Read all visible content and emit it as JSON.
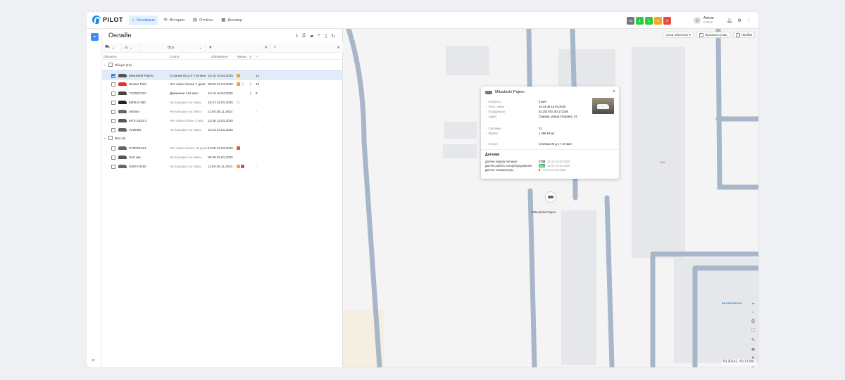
{
  "brand": {
    "name": "PILOT"
  },
  "nav": {
    "tabs": [
      {
        "label": "Основные",
        "icon": "home-icon"
      },
      {
        "label": "История",
        "icon": "history-icon"
      },
      {
        "label": "Отчёты",
        "icon": "report-icon"
      },
      {
        "label": "Договор",
        "icon": "contract-icon"
      }
    ]
  },
  "status_badges": [
    {
      "count": "10",
      "color": "#777777"
    },
    {
      "count": "1",
      "color": "#2ecc40"
    },
    {
      "count": "1",
      "color": "#2ecc40"
    },
    {
      "count": "0",
      "color": "#f5a623"
    },
    {
      "count": "0",
      "color": "#e74c3c"
    }
  ],
  "user": {
    "name": "Алена",
    "balance": "0.00 ₽"
  },
  "panel": {
    "title": "Онлайн",
    "filter_all": "Все",
    "columns": {
      "objects": "Объекты",
      "status": "Статус",
      "updated": "Обновлено",
      "tags": "Метки"
    }
  },
  "groups": [
    {
      "label": "Общая (10)"
    },
    {
      "label": "Моя (3)"
    }
  ],
  "vehicles": [
    {
      "name": "Mitsubishi Pajero",
      "status": "Стоянка 00 д 4 ч 39 мин",
      "updated": "16:16 10.04.2025",
      "extra": "12",
      "color": "#555"
    },
    {
      "name": "Nissan Tiida",
      "status": "Нет связи более 7 дней",
      "updated": "08:53 04.04.2025",
      "extra": "19",
      "color": "#d33"
    },
    {
      "name": "T100ЕЕ761",
      "status": "Движение 144 км/ч",
      "updated": "16:19 10.04.2025",
      "extra": "9",
      "color": "#444"
    },
    {
      "name": "К804АУ190",
      "status": "Не выходил на связь",
      "updated": "16:21 23.01.2025",
      "extra": "-",
      "color": "#222"
    },
    {
      "name": "х804ка",
      "status": "Не выходил на связь",
      "updated": "11:50 28.11.2024",
      "extra": "-",
      "color": "#666"
    },
    {
      "name": "МТЗ-1523.3",
      "status": "Нет связи более 3 мес.",
      "updated": "13:48 13.01.2025",
      "extra": "-",
      "color": "#555"
    },
    {
      "name": "У2354М",
      "status": "Не выходил на связь",
      "updated": "10:10 24.01.2025",
      "extra": "-",
      "color": "#666"
    },
    {
      "name": "Р100РЕ161",
      "status": "Нет связи более 18 дней",
      "updated": "12:05 24.03.2025",
      "extra": "-",
      "color": "#666"
    },
    {
      "name": "Test wip",
      "status": "Не выходил на связь",
      "updated": "09:48 03.01.2025",
      "extra": "-",
      "color": "#555"
    },
    {
      "name": "Х067УН190",
      "status": "Не выходил на связь",
      "updated": "11:56 25.11.2024",
      "extra": "-",
      "color": "#666"
    }
  ],
  "map": {
    "layers_button": "Слои объектов",
    "street_view": "Просмотр улиц",
    "traffic": "Пробки",
    "street_label": "автомобильн",
    "building_label": "4/13",
    "marker_label": "Mitsubishi Pajero",
    "coordinates": "53.20161, 50.17156"
  },
  "popup": {
    "title": "Mitsubishi Pajero",
    "rows": [
      {
        "k": "Скорость",
        "v": "0 км/ч"
      },
      {
        "k": "Посл. связь",
        "v": "16:14:48 10.04.2025"
      },
      {
        "k": "Координаты",
        "v": "53.201700, 50.172100"
      },
      {
        "k": "Адрес",
        "v": "Самара, улица Гагарина, 24"
      }
    ],
    "rows2": [
      {
        "k": "Спутники",
        "v": "12"
      },
      {
        "k": "Пробег",
        "v": "1 406.63 км"
      }
    ],
    "status_k": "Статус",
    "status_v": "Стоянка 00 д 4 ч 37 мин",
    "sensors_title": "Датчики",
    "sensors": [
      {
        "k": "Датчик заряда батареи",
        "v": "2708",
        "t": "14:16 03.02.2025"
      },
      {
        "k": "Датчик работы спецоборудования",
        "v": "вкл",
        "t": "13:10 13.02.2025"
      },
      {
        "k": "Датчик температуры",
        "v": "0",
        "t": "12:14 10.02.2025"
      }
    ]
  }
}
